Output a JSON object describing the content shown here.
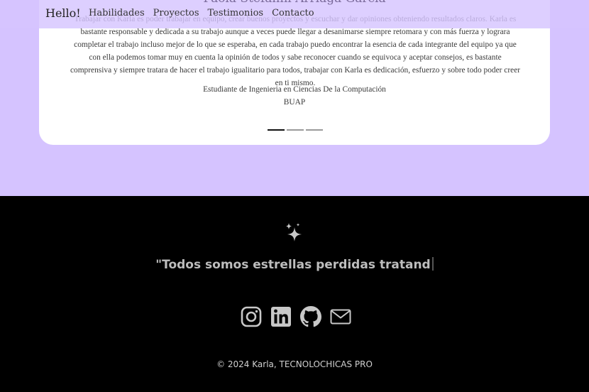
{
  "nav": {
    "brand": "Hello!",
    "links": [
      "Habilidades",
      "Proyectos",
      "Testimonios",
      "Contacto"
    ]
  },
  "testimonial": {
    "name": "Paola Stefanni Arriaga Garcia",
    "text": "Trabajar con Karla es poder trabajar en equipo, crear buenos proyectos y escuchar y dar opiniones obteniendo resultados claros. Karla es bastante responsable y dedicada a su trabajo aunque a veces puede llegar a desanimarse siempre retomara y con más fuerza y lograra completar el trabajo incluso mejor de lo que se esperaba, en cada trabajo puedo encontrar la esencia de cada integrante del equipo ya que con ella podemos tomar muy en cuenta la opinión de todos y sabe reconocer cuando se equivoca y aceptar consejos, es bastante comprensiva y siempre tratara de hacer el trabajo igualitario para todos, trabajar con Karla es dedicación, esfuerzo y sobre todo poder creer en ti mismo.",
    "role": "Estudiante de Ingenieria en Ciencias De la Computación",
    "org": "BUAP"
  },
  "footer": {
    "quote": "\"Todos somos estrellas perdidas tratand",
    "copyright": "© 2024 Karla, TECNOLOCHICAS PRO",
    "icons": [
      "sparkles-icon",
      "instagram-icon",
      "linkedin-icon",
      "github-icon",
      "mail-icon"
    ]
  },
  "colors": {
    "background": "#d5c3ff",
    "card": "#ffffff",
    "footer": "#000000",
    "icon": "#c8c8c8"
  }
}
